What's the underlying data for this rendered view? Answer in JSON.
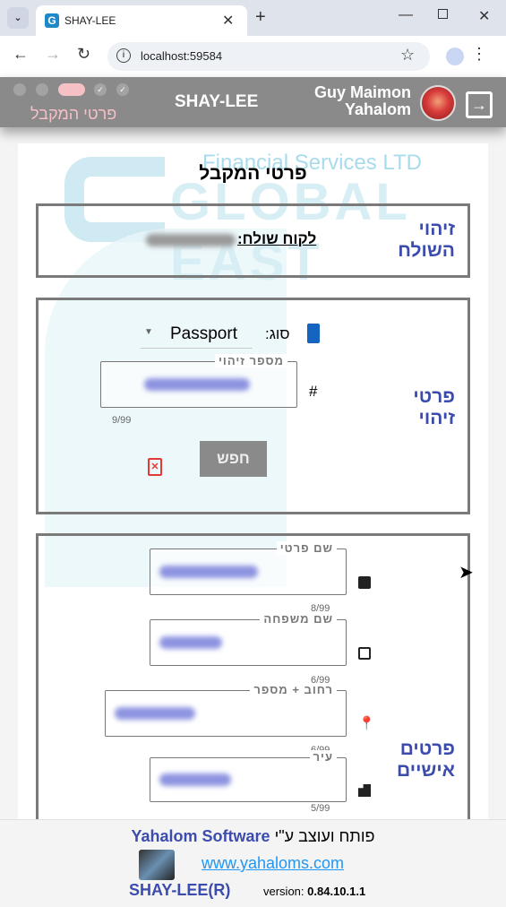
{
  "browser": {
    "tab_title": "SHAY-LEE",
    "url": "localhost:59584",
    "new_tab": "+"
  },
  "appbar": {
    "page_name": "פרטי המקבל",
    "app_name": "SHAY-LEE",
    "user_name_line1": "Guy Maimon",
    "user_name_line2": "Yahalom"
  },
  "watermark": {
    "line1": "Financial Services LTD",
    "line2": "GLOBAL EAST"
  },
  "page": {
    "title": "פרטי המקבל"
  },
  "sender": {
    "section": "זיהוי השולח",
    "label": "לקוח שולח:"
  },
  "identification": {
    "section": "פרטי זיהוי",
    "type_label": "סוג:",
    "type_value": "Passport",
    "id_label": "מספר זיהוי",
    "hash": "#",
    "id_counter": "9/99",
    "search_button": "חפש"
  },
  "personal": {
    "section": "פרטים אישיים",
    "fields": [
      {
        "label": "שם פרטי",
        "counter": "8/99"
      },
      {
        "label": "שם משפחה",
        "counter": "6/99"
      },
      {
        "label": "רחוב + מספר",
        "counter": "6/99"
      },
      {
        "label": "עיר",
        "counter": "5/99"
      }
    ]
  },
  "footer": {
    "credit_prefix": "פותח ועוצב ע\"י",
    "credit_brand": "Yahalom Software",
    "link": "www.yahaloms.com",
    "product": "SHAY-LEE(R)",
    "version_label": "version:",
    "version": "0.84.10.1.1"
  },
  "colors": {
    "accent": "#3b4cae",
    "appbar": "#8a8a8a",
    "link": "#2196f3",
    "delete": "#e53935"
  }
}
